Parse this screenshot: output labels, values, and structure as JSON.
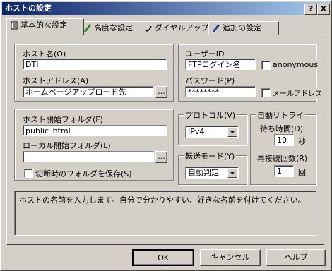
{
  "window": {
    "title": "ホストの設定",
    "help_btn": "?",
    "close_btn": "X"
  },
  "tabs": [
    {
      "label": "基本的な設定"
    },
    {
      "label": "高度な設定"
    },
    {
      "label": "ダイヤルアップ"
    },
    {
      "label": "追加の設定"
    }
  ],
  "host": {
    "name_label": "ホスト名(O)",
    "name_value": "DTI",
    "address_label": "ホストアドレス(A)",
    "address_value": "ホームページアップロード先",
    "browse": "..."
  },
  "user": {
    "id_label": "ユーザーID",
    "id_value": "FTPログイン名",
    "anonymous": "anonymous",
    "password_label": "パスワード(P)",
    "password_value": "********",
    "mail": "メールアドレス"
  },
  "folders": {
    "host_label": "ホスト開始フォルダ(F)",
    "host_value": "public_html",
    "local_label": "ローカル開始フォルダ(L)",
    "local_value": "",
    "browse": "...",
    "save_on_disconnect": "切断時のフォルダを保存(S)"
  },
  "protocol": {
    "label": "プロトコル(V)",
    "value": "IPv4"
  },
  "transfer": {
    "label": "転送モード(Y)",
    "value": "自動判定"
  },
  "retry": {
    "label": "自動リトライ",
    "wait_label": "待ち時間(D)",
    "wait_value": "10",
    "wait_unit": "秒",
    "count_label": "再接続回数(R)",
    "count_value": "1",
    "count_unit": "回"
  },
  "help_text": "ホストの名前を入力します。自分で分かりやすい、好きな名前を付けてください。",
  "buttons": {
    "ok": "OK",
    "cancel": "キャンセル",
    "help": "ヘルプ"
  }
}
